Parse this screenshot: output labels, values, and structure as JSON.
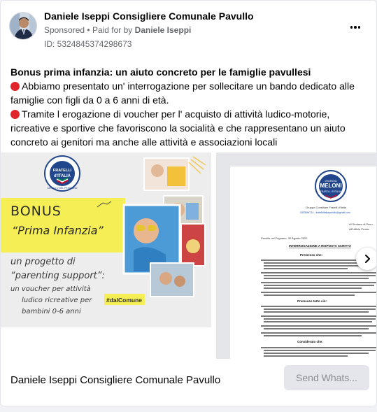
{
  "post": {
    "page_name": "Daniele Iseppi Consigliere Comunale Pavullo",
    "sponsored": "Sponsored",
    "separator": "•",
    "paid_for_prefix": "Paid for by",
    "paid_for_name": "Daniele Iseppi",
    "ad_id": "ID: 5324845374298673",
    "more_icon": "more-horizontal-icon"
  },
  "body": {
    "title": "Bonus prima infanzia: un aiuto concreto per le famiglie pavullesi",
    "para1": "Abbiamo presentato un' interrogazione per sollecitare un bando dedicato alle famiglie con figli da 0 a 6 anni di età.",
    "para2": "Tramite l erogazione di voucher per l' acquisto di attività ludico-motorie, ricreative e sportive che favoriscono la socialità e che rappresentano un aiuto concreto ai genitori ma anche alle attività e associazioni locali",
    "bullet_color": "#e0242b"
  },
  "slide1": {
    "logo_line1": "FRATELLI",
    "logo_line2": "d'ITALIA",
    "logo_ring": "CIRCOLO DEL FRIGNANO",
    "bonus": "BONUS",
    "prima": "“Prima Infanzia”",
    "progetto1": "un   progetto  di",
    "progetto2": "“parenting support”:",
    "progetto3": "un voucher per attività",
    "progetto4": "ludico ricreative per",
    "progetto5": "bambini 0-6 anni",
    "hashtag": "#dalComune",
    "accent_yellow": "#f5ee55",
    "accent_blue": "#2a6fb6"
  },
  "slide2": {
    "logo_name": "MELONI",
    "logo_sub1": "GIORGIA",
    "logo_sub2": "FRATELLI D'ITALIA",
    "group": "Gruppo Consiliare Fratelli d'Italia",
    "phone": "3333694714 - fratelliditaliapavullo@gmail.com",
    "to1": "Al Sindaco di Pavu",
    "to2": "All'Ufficio Protoc",
    "date": "Pavullo nel Frignano, 30 Agosto 2022",
    "subject": "INTERROGAZIONE A RISPOSTA SCRITTA",
    "premesso": "Premesso che:",
    "premesso_tanto": "Premesso tutto ciò:",
    "considerato": "Considerato che:"
  },
  "footer": {
    "name": "Daniele Iseppi Consigliere Comunale Pavullo",
    "send_label": "Send Whats..."
  },
  "carousel": {
    "next_icon": "chevron-right-icon"
  }
}
